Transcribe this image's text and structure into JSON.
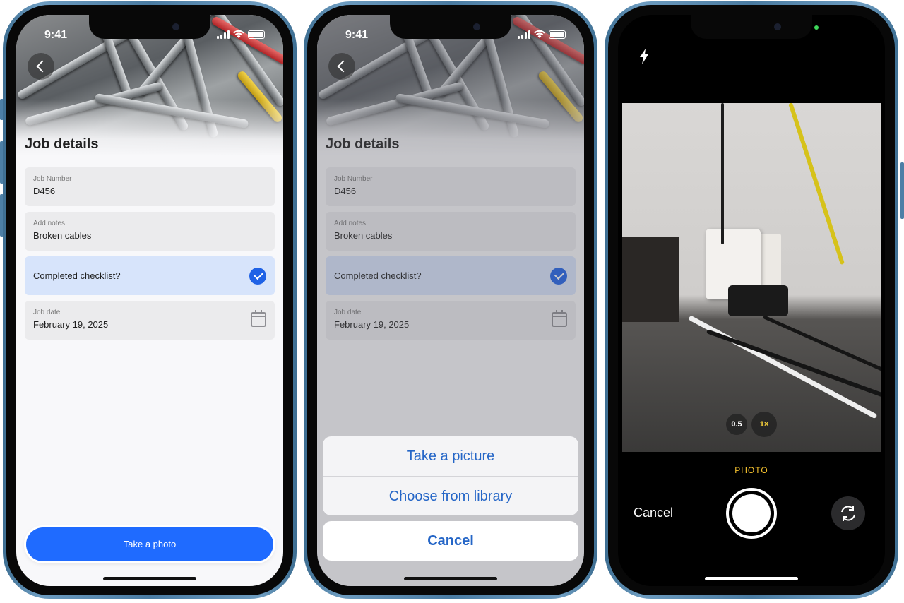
{
  "status_bar": {
    "time": "9:41"
  },
  "job_screen": {
    "title": "Job details",
    "fields": {
      "job_number": {
        "label": "Job Number",
        "value": "D456"
      },
      "notes": {
        "label": "Add notes",
        "value": "Broken cables"
      },
      "checklist": {
        "label": "Completed checklist?",
        "checked": true
      },
      "job_date": {
        "label": "Job date",
        "value": "February 19, 2025"
      }
    },
    "primary_button": "Take a photo"
  },
  "action_sheet": {
    "options": [
      "Take a picture",
      "Choose from library"
    ],
    "cancel": "Cancel"
  },
  "camera": {
    "zoom_options": [
      "0.5",
      "1×"
    ],
    "active_zoom": "1×",
    "mode": "PHOTO",
    "cancel": "Cancel"
  },
  "colors": {
    "accent": "#1f6bff",
    "check_bg": "#d7e4fb",
    "sheet_text": "#2566c7",
    "camera_mode": "#f7c32e",
    "frame": "#4a7ba1"
  }
}
